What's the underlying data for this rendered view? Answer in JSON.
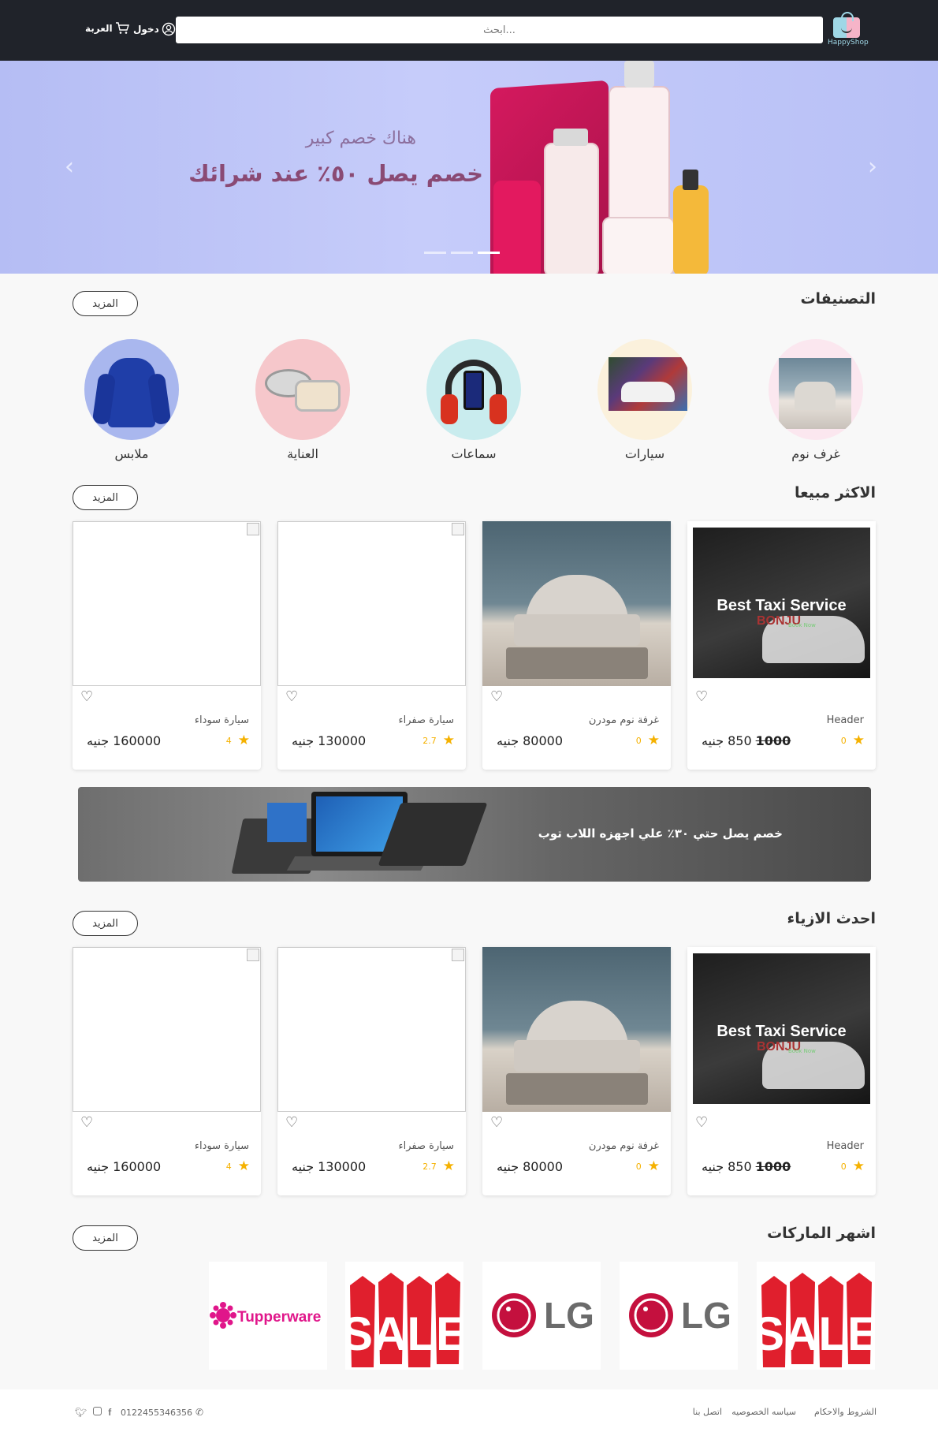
{
  "header": {
    "logo_text": "HappyShop",
    "search_placeholder": "ابحث...",
    "login_label": "دخول",
    "language_label": "العربة"
  },
  "hero": {
    "subtitle": "هناك خصم كبير",
    "headline": "خصم يصل ٥٠٪ عند شرائك",
    "slides_count": 3,
    "active_slide": 3
  },
  "categories": {
    "title": "التصنيفات",
    "more_label": "المزيد",
    "items": [
      {
        "label": "غرف نوم",
        "icon": "bedroom-thumbnail"
      },
      {
        "label": "سيارات",
        "icon": "car-thumbnail"
      },
      {
        "label": "سماعات",
        "icon": "headphones-thumbnail"
      },
      {
        "label": "العناية",
        "icon": "cream-jar-thumbnail"
      },
      {
        "label": "ملابس",
        "icon": "hoodie-thumbnail"
      }
    ]
  },
  "best_sellers": {
    "title": "الاكثر مبيعا",
    "more_label": "المزيد",
    "products": [
      {
        "name": "Header",
        "rating": "0",
        "price": "850",
        "old_price": "1000",
        "currency": "جنيه",
        "image": "taxi-service-banner"
      },
      {
        "name": "غرفة نوم مودرن",
        "rating": "0",
        "price": "80000",
        "old_price": "",
        "currency": "جنيه",
        "image": "bedroom-photo"
      },
      {
        "name": "سيارة صفراء",
        "rating": "2.7",
        "price": "130000",
        "old_price": "",
        "currency": "جنيه",
        "image": "broken-image"
      },
      {
        "name": "سيارة سوداء",
        "rating": "4",
        "price": "160000",
        "old_price": "",
        "currency": "جنيه",
        "image": "broken-image"
      }
    ]
  },
  "promo": {
    "text": "خصم يصل حتي ٣٠٪ علي اجهزه اللاب توب"
  },
  "latest_fashion": {
    "title": "احدث الازياء",
    "more_label": "المزيد",
    "products": [
      {
        "name": "Header",
        "rating": "0",
        "price": "850",
        "old_price": "1000",
        "currency": "جنيه",
        "image": "taxi-service-banner"
      },
      {
        "name": "غرفة نوم مودرن",
        "rating": "0",
        "price": "80000",
        "old_price": "",
        "currency": "جنيه",
        "image": "bedroom-photo"
      },
      {
        "name": "سيارة صفراء",
        "rating": "2.7",
        "price": "130000",
        "old_price": "",
        "currency": "جنيه",
        "image": "broken-image"
      },
      {
        "name": "سيارة سوداء",
        "rating": "4",
        "price": "160000",
        "old_price": "",
        "currency": "جنيه",
        "image": "broken-image"
      }
    ]
  },
  "brands": {
    "title": "اشهر الماركات",
    "more_label": "المزيد",
    "items": [
      {
        "name": "SALE",
        "logo": "sale-tags-logo"
      },
      {
        "name": "LG",
        "logo": "lg-logo"
      },
      {
        "name": "LG",
        "logo": "lg-logo"
      },
      {
        "name": "SALE",
        "logo": "sale-tags-logo"
      },
      {
        "name": "Tupperware",
        "logo": "tupperware-logo"
      }
    ]
  },
  "product_card_texts": {
    "taxi_banner_title": "Best Taxi Service",
    "taxi_banner_brand": "BONJU",
    "taxi_banner_button": "Book Now"
  },
  "footer": {
    "terms": "الشروط والاحكام",
    "privacy": "سياسه الخصوصيه",
    "contact": "اتصل بنا",
    "phone": "0122455346356",
    "social": [
      "twitter-icon",
      "instagram-icon",
      "facebook-icon"
    ]
  },
  "colors": {
    "header_bg": "#20232a",
    "hero_bg": "#c6ccfa",
    "page_bg": "#f8f8f8",
    "star": "#f5b100",
    "hero_headline": "#8a4a74"
  }
}
